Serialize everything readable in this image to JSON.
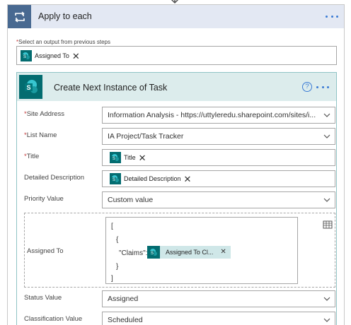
{
  "loop": {
    "title": "Apply to each",
    "select_output_label": "Select an output from previous steps",
    "select_output_required": "*",
    "token_label": "Assigned To",
    "token_remove": "✕"
  },
  "action": {
    "title": "Create Next Instance of Task",
    "help": "?",
    "fields": {
      "site_address": {
        "label": "Site Address",
        "required": "*",
        "value": "Information Analysis - https://uttyleredu.sharepoint.com/sites/i..."
      },
      "list_name": {
        "label": "List Name",
        "required": "*",
        "value": "IA Project/Task Tracker"
      },
      "title": {
        "label": "Title",
        "required": "*",
        "token": "Title",
        "token_remove": "✕"
      },
      "detailed_description": {
        "label": "Detailed Description",
        "token": "Detailed Description",
        "token_remove": "✕"
      },
      "priority_value": {
        "label": "Priority Value",
        "value": "Custom value"
      },
      "assigned_to": {
        "label": "Assigned To",
        "line_open_bracket": "[",
        "line_open_brace": "{",
        "claims_key": "\"Claims\":",
        "token": "Assigned To Cl...",
        "token_remove": "✕",
        "line_close_brace": "}",
        "line_close_bracket": "]"
      },
      "status_value": {
        "label": "Status Value",
        "value": "Assigned"
      },
      "classification_value": {
        "label": "Classification Value",
        "value": "Scheduled"
      }
    }
  },
  "colors": {
    "loop_header_bg": "#e3e8f3",
    "loop_icon_bg": "#486991",
    "sharepoint_teal": "#036c70",
    "action_header_bg": "#dcecec",
    "link_blue": "#3a7bd5",
    "required_red": "#c43c3c"
  },
  "icons": [
    "down-arrow-icon",
    "loop-icon",
    "more-options-icon",
    "sharepoint-icon",
    "help-icon",
    "chevron-down-icon",
    "remove-token-icon",
    "table-view-icon"
  ]
}
